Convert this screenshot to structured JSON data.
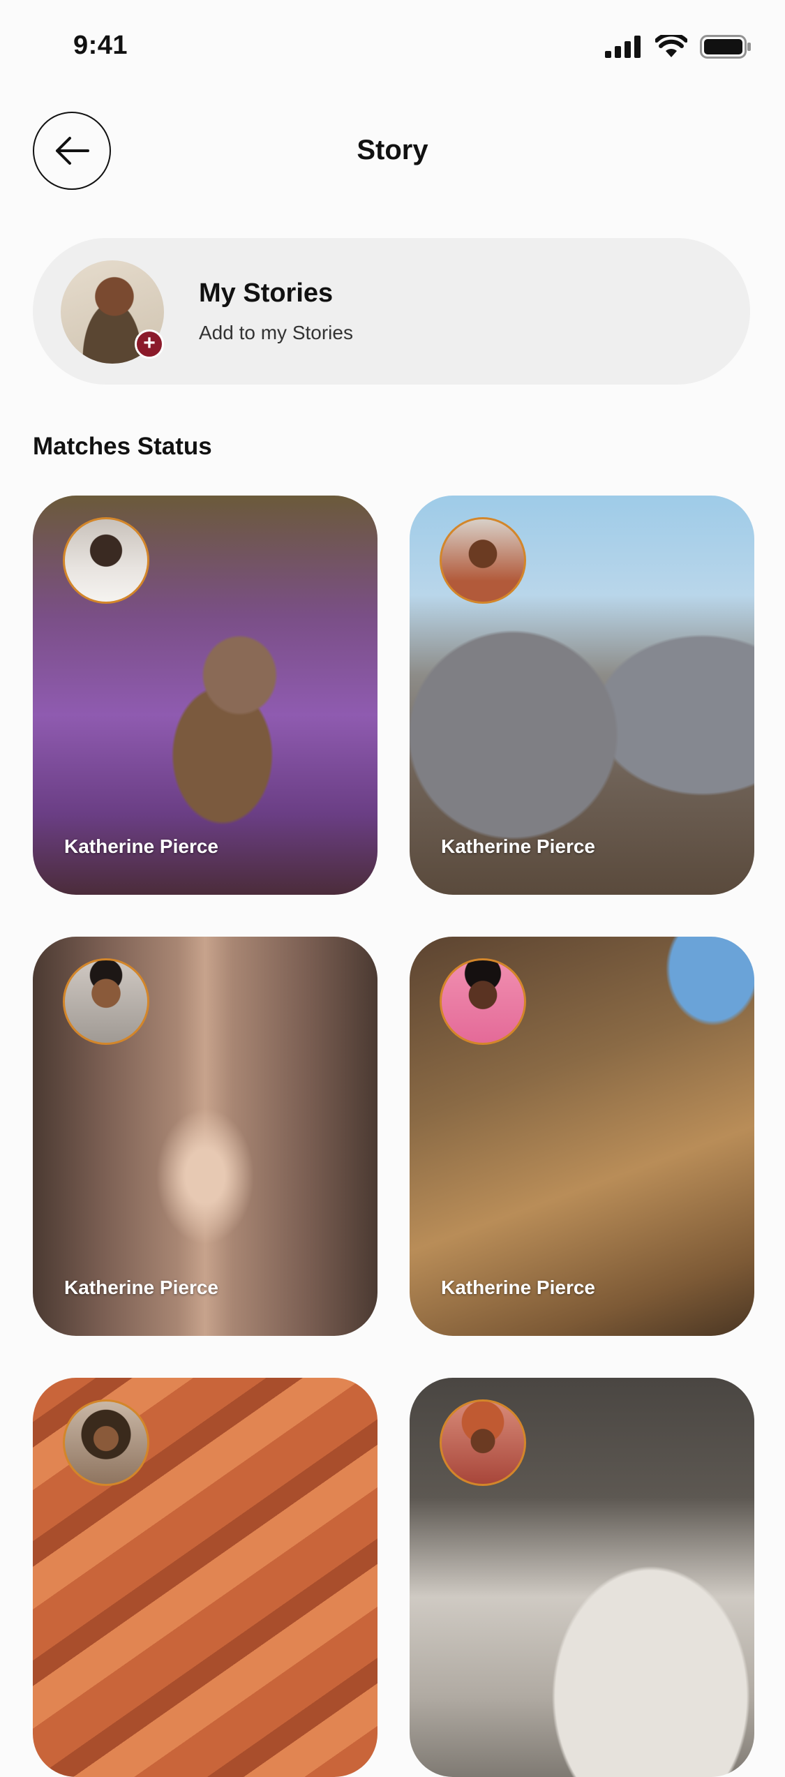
{
  "status_bar": {
    "time": "9:41"
  },
  "header": {
    "title": "Story"
  },
  "my_stories": {
    "title": "My Stories",
    "subtitle": "Add to my Stories",
    "badge": "+"
  },
  "section": {
    "title": "Matches Status"
  },
  "colors": {
    "accent": "#8b1a2a",
    "ring": "#d3862a"
  },
  "stories": [
    {
      "name": "Katherine Pierce"
    },
    {
      "name": "Katherine Pierce"
    },
    {
      "name": "Katherine Pierce"
    },
    {
      "name": "Katherine Pierce"
    },
    {
      "name": ""
    },
    {
      "name": ""
    }
  ]
}
